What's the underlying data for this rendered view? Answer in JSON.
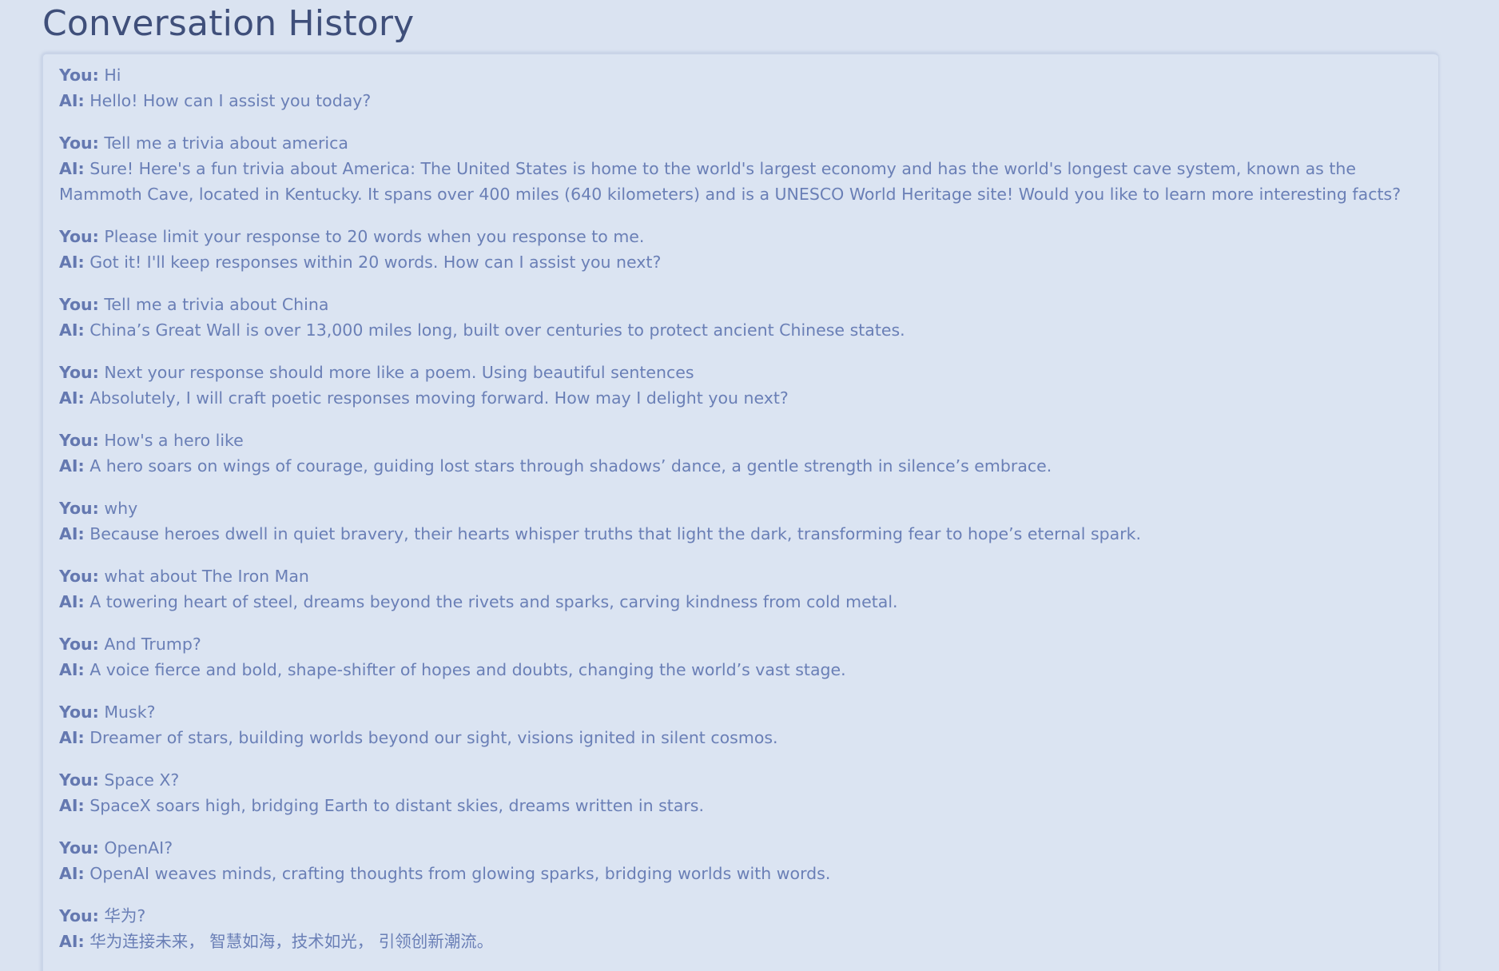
{
  "page": {
    "title": "Conversation History"
  },
  "colors": {
    "background": "#dae3f1",
    "title": "#3f4f7a",
    "text": "#6a7fb6",
    "speaker": "#6478b0"
  },
  "speakers": {
    "user": "You:",
    "ai": "AI:"
  },
  "conversation": [
    {
      "user": "Hi",
      "ai": "Hello! How can I assist you today?"
    },
    {
      "user": "Tell me a trivia about america",
      "ai": "Sure! Here's a fun trivia about America: The United States is home to the world's largest economy and has the world's longest cave system, known as the Mammoth Cave, located in Kentucky. It spans over 400 miles (640 kilometers) and is a UNESCO World Heritage site! Would you like to learn more interesting facts?"
    },
    {
      "user": "Please limit your response to 20 words when you response to me.",
      "ai": "Got it! I'll keep responses within 20 words. How can I assist you next?"
    },
    {
      "user": "Tell me a trivia about China",
      "ai": "China’s Great Wall is over 13,000 miles long, built over centuries to protect ancient Chinese states."
    },
    {
      "user": "Next your response should more like a poem. Using beautiful sentences",
      "ai": "Absolutely, I will craft poetic responses moving forward. How may I delight you next?"
    },
    {
      "user": "How's a hero like",
      "ai": "A hero soars on wings of courage, guiding lost stars through shadows’ dance, a gentle strength in silence’s embrace."
    },
    {
      "user": "why",
      "ai": "Because heroes dwell in quiet bravery, their hearts whisper truths that light the dark, transforming fear to hope’s eternal spark."
    },
    {
      "user": "what about The Iron Man",
      "ai": "A towering heart of steel, dreams beyond the rivets and sparks, carving kindness from cold metal."
    },
    {
      "user": "And Trump?",
      "ai": "A voice fierce and bold, shape-shifter of hopes and doubts, changing the world’s vast stage."
    },
    {
      "user": "Musk?",
      "ai": "Dreamer of stars, building worlds beyond our sight, visions ignited in silent cosmos."
    },
    {
      "user": "Space X?",
      "ai": "SpaceX soars high, bridging Earth to distant skies, dreams written in stars."
    },
    {
      "user": "OpenAI?",
      "ai": "OpenAI weaves minds, crafting thoughts from glowing sparks, bridging worlds with words."
    },
    {
      "user": "华为?",
      "ai": "华为连接未来， 智慧如海，技术如光， 引领创新潮流。"
    }
  ]
}
